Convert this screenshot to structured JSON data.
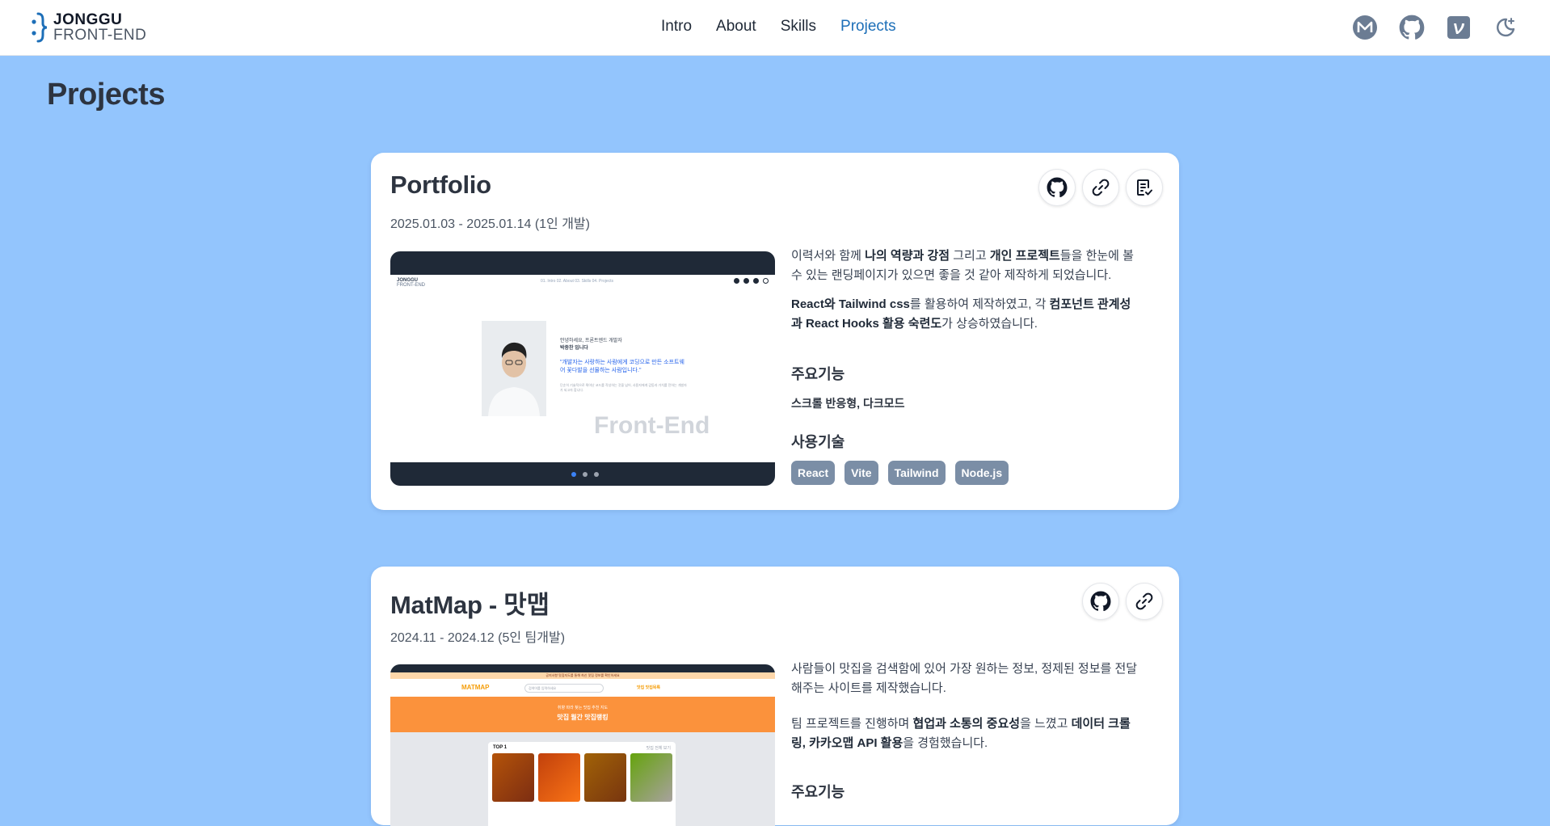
{
  "header": {
    "logo_top": "JONGGU",
    "logo_bottom": "FRONT-END",
    "nav": [
      "Intro",
      "About",
      "Skills",
      "Projects"
    ],
    "active_nav": "Projects",
    "icons": [
      "medium-icon",
      "github-icon",
      "velog-icon",
      "dark-mode-icon"
    ]
  },
  "page": {
    "title": "Projects"
  },
  "colors": {
    "background": "#93c5fd",
    "accent": "#1d6fb8",
    "tag": "#7b8ea6"
  },
  "projects": [
    {
      "title": "Portfolio",
      "date": "2025.01.03 - 2025.01.14 (1인 개발)",
      "actions": [
        "github-icon",
        "link-icon",
        "document-check-icon"
      ],
      "screenshot": {
        "logo_top": "JONGGU",
        "logo_bottom": "FRONT-END",
        "menu": "01. Intro    02. About    03. Skills    04. Projects",
        "greeting": "안녕하세요, 프론트엔드 개발자",
        "name_line": "박종찬 입니다",
        "quote": "\"개발자는 사랑하는 사람에게 코딩으로 만든 소프트웨어 꽃다발을 선물하는 사람입니다.\"",
        "body": "단순히 기술적으로 뛰어난 코드를 작성하는 것을 넘어, 사용자에게 감동과 가치를 전하는 개발자가 되고자 합니다.",
        "brand": "Front-End",
        "slides": 3,
        "active_slide": 1
      },
      "desc_parts": [
        {
          "t": "이력서와 함께 ",
          "b": false
        },
        {
          "t": "나의 역량과 강점",
          "b": true
        },
        {
          "t": " 그리고 ",
          "b": false
        },
        {
          "t": "개인 프로젝트",
          "b": true
        },
        {
          "t": "들을 한눈에 볼 수 있는 랜딩페이지가 있으면 좋을 것 같아 제작하게 되었습니다.",
          "b": false
        }
      ],
      "desc2_parts": [
        {
          "t": "React와 Tailwind css",
          "b": true
        },
        {
          "t": "를 활용하여 제작하였고, 각 ",
          "b": false
        },
        {
          "t": "컴포넌트 관계성과 React Hooks 활용 숙련도",
          "b": true
        },
        {
          "t": "가 상승하였습니다.",
          "b": false
        }
      ],
      "features_heading": "주요기능",
      "features": "스크롤 반응형, 다크모드",
      "tech_heading": "사용기술",
      "tech": [
        "React",
        "Vite",
        "Tailwind",
        "Node.js"
      ]
    },
    {
      "title": "MatMap - 맛맵",
      "date": "2024.11 - 2024.12 (5인 팀개발)",
      "actions": [
        "github-icon",
        "link-icon"
      ],
      "screenshot": {
        "banner": "공지사항 맛집지도를 통해 최신 맛집 정보를 확인하세요",
        "logo": "MATMAP",
        "search_placeholder": "검색어를 입력하세요",
        "menu": "맛집    맛집목록",
        "hero_line1": "취향 따라 찾는 맛집 추천 지도",
        "hero_line2": "맛집 월간 맛집랭킹",
        "top_label": "TOP 1",
        "more": "맛집 전체 보기"
      },
      "desc_parts": [
        {
          "t": "사람들이 맛집을 검색함에 있어 가장 원하는 정보, 정제된 정보를 전달해주는 사이트를 제작했습니다.",
          "b": false
        }
      ],
      "desc2_parts": [
        {
          "t": "팀 프로젝트를 진행하며 ",
          "b": false
        },
        {
          "t": "협업과 소통의 중요성",
          "b": true
        },
        {
          "t": "을 느꼈고 ",
          "b": false
        },
        {
          "t": "데이터 크롤링, 카카오맵 API 활용",
          "b": true
        },
        {
          "t": "을 경험했습니다.",
          "b": false
        }
      ],
      "features_heading": "주요기능"
    }
  ]
}
